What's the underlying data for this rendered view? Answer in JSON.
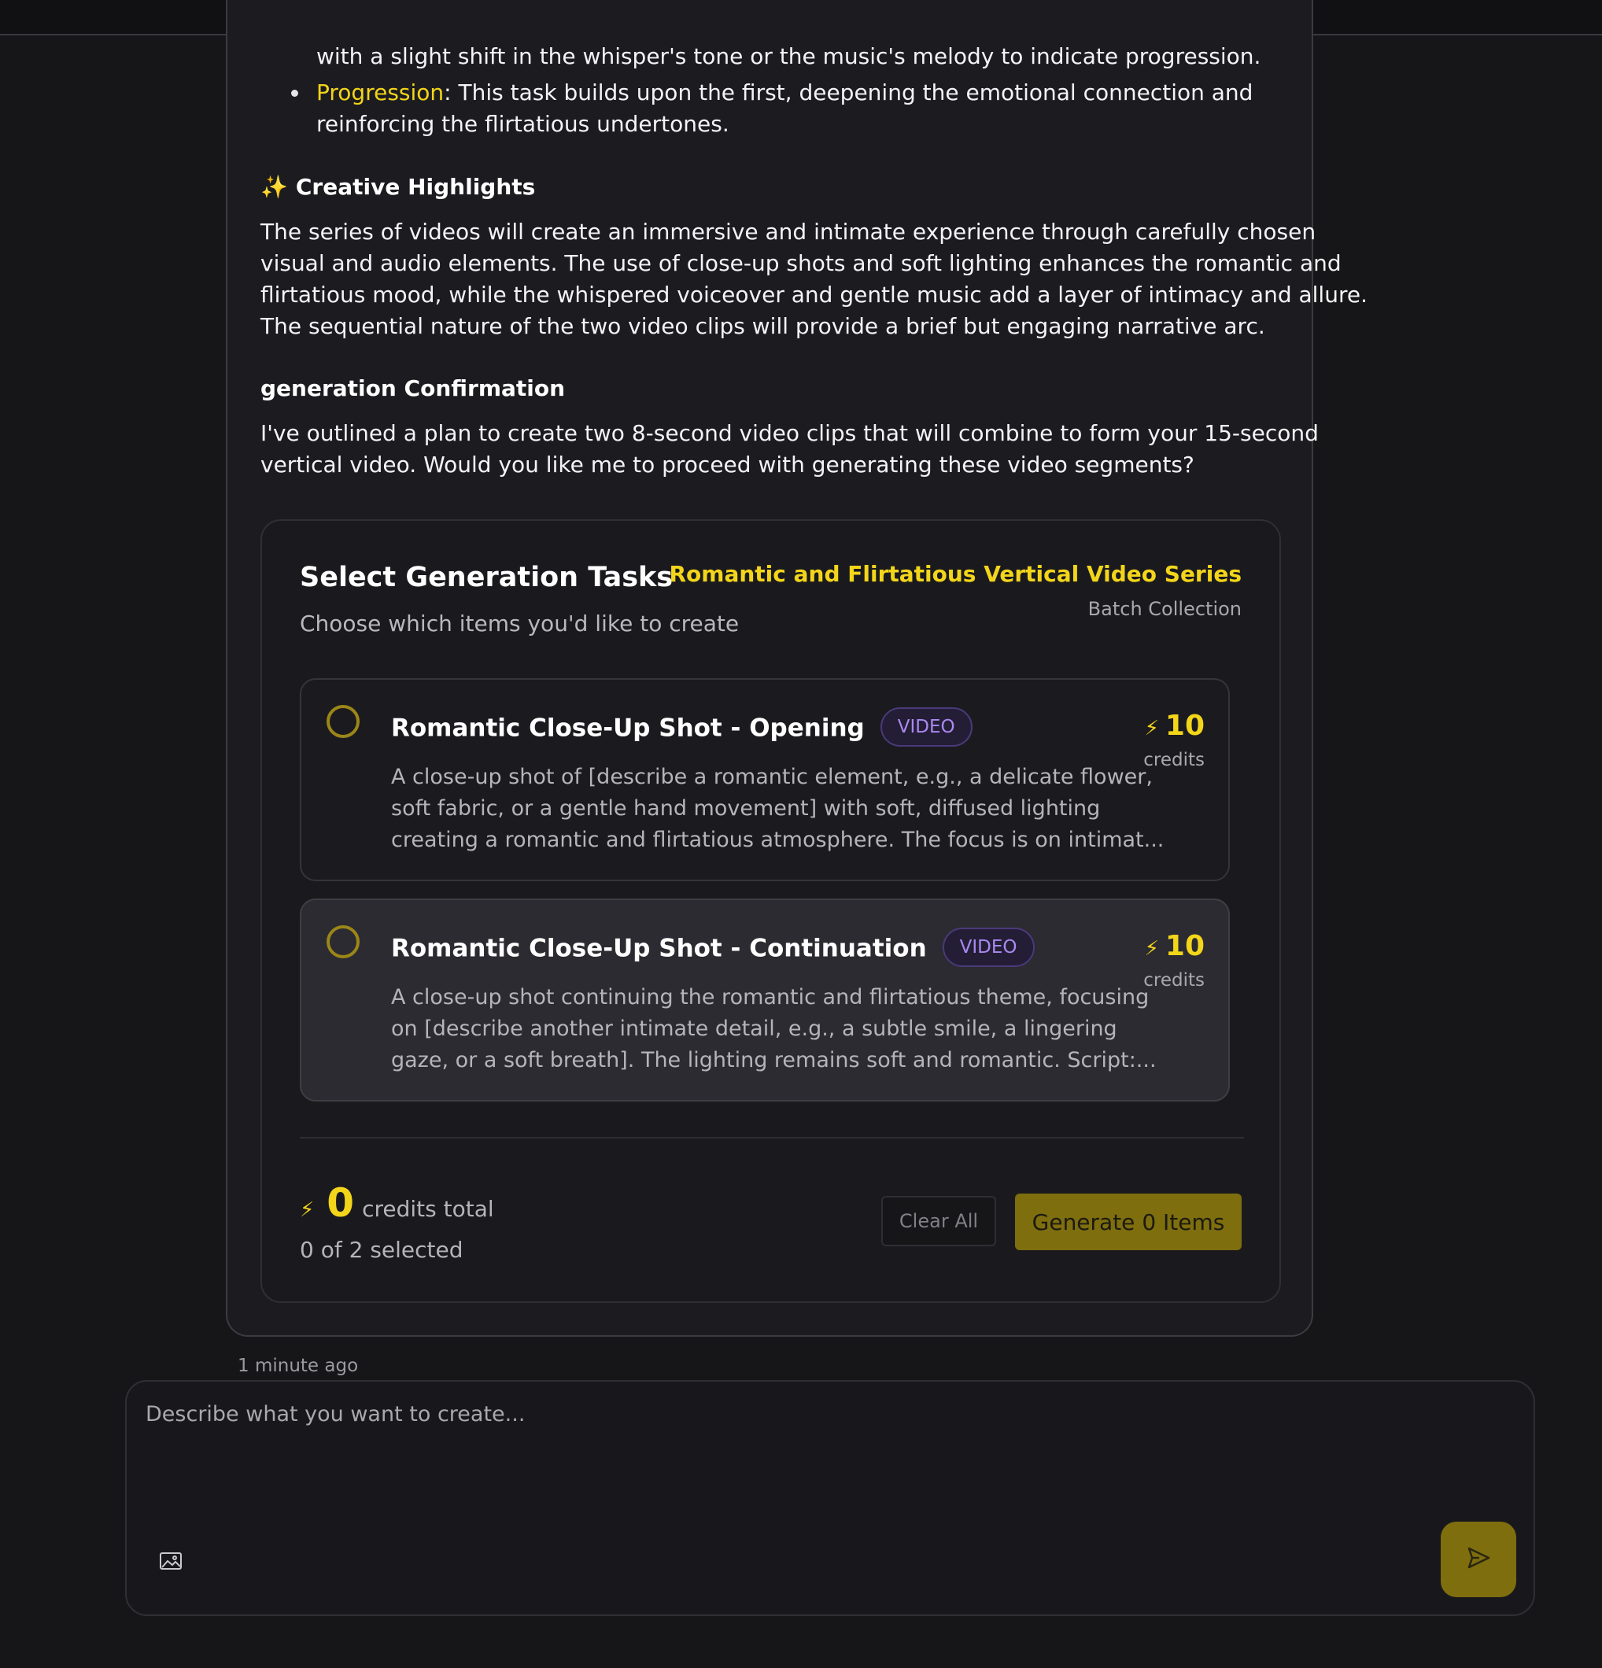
{
  "message": {
    "bullets": [
      {
        "text_lines": [
          "with a slight shift in the whisper's tone or the music's melody to indicate progression."
        ]
      },
      {
        "highlight": "Progression",
        "text_lines": [
          ": This task builds upon the first, deepening the emotional connection and",
          "reinforcing the flirtatious undertones."
        ]
      }
    ],
    "creative_highlights": {
      "title": "Creative Highlights",
      "lines": [
        "The series of videos will create an immersive and intimate experience through carefully chosen",
        "visual and audio elements. The use of close-up shots and soft lighting enhances the romantic and",
        "flirtatious mood, while the whispered voiceover and gentle music add a layer of intimacy and allure.",
        "The sequential nature of the two video clips will provide a brief but engaging narrative arc."
      ]
    },
    "confirmation": {
      "title": "generation Confirmation",
      "lines": [
        "I've outlined a plan to create two 8-second video clips that will combine to form your 15-second",
        "vertical video. Would you like me to proceed with generating these video segments?"
      ]
    }
  },
  "task_panel": {
    "title": "Select Generation Tasks",
    "subtitle": "Choose which items you'd like to create",
    "series_name": "Romantic and Flirtatious Vertical Video Series",
    "collection_label": "Batch Collection",
    "items": [
      {
        "title": "Romantic Close-Up Shot - Opening",
        "badge": "VIDEO",
        "desc_lines": [
          "A close-up shot of [describe a romantic element, e.g., a delicate flower,",
          "soft fabric, or a gentle hand movement] with soft, diffused lighting",
          "creating a romantic and flirtatious atmosphere. The focus is on intimat..."
        ],
        "credits": "10",
        "credits_label": "credits",
        "selected": false
      },
      {
        "title": "Romantic Close-Up Shot - Continuation",
        "badge": "VIDEO",
        "desc_lines": [
          "A close-up shot continuing the romantic and flirtatious theme, focusing",
          "on [describe another intimate detail, e.g., a subtle smile, a lingering",
          "gaze, or a soft breath]. The lighting remains soft and romantic. Script:..."
        ],
        "credits": "10",
        "credits_label": "credits",
        "selected": false
      }
    ],
    "total_credits": "0",
    "total_label": "credits total",
    "selected_count": "0 of 2 selected",
    "clear_label": "Clear All",
    "generate_label": "Generate 0 Items"
  },
  "timestamp": "1 minute ago",
  "composer": {
    "placeholder": "Describe what you want to create...",
    "attach_icon": "image-icon",
    "send_icon": "send-icon"
  },
  "colors": {
    "accent": "#f3d51a",
    "accent_button": "#7e6e0e",
    "badge": "#a98af0",
    "background": "#161619"
  }
}
